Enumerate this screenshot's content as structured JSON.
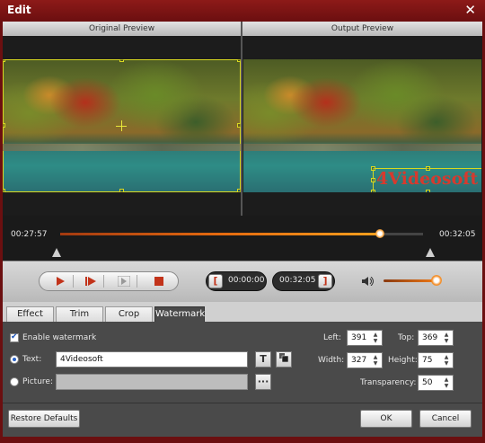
{
  "window": {
    "title": "Edit",
    "close_glyph": "✕"
  },
  "preview": {
    "original_label": "Original Preview",
    "output_label": "Output Preview",
    "watermark_overlay_text": "4Videosoft"
  },
  "timeline": {
    "start_time": "00:27:57",
    "end_time": "00:32:05",
    "progress": 0.88
  },
  "controls": {
    "play_icon": "play-icon",
    "next_frame_icon": "next-frame-icon",
    "frame_step_icon": "frame-step-icon",
    "stop_icon": "stop-icon",
    "clip_start_bracket": "[",
    "clip_start_time": "00:00:00",
    "clip_end_time": "00:32:05",
    "clip_end_bracket": "]",
    "volume_icon": "volume-icon",
    "volume_level": 0.85
  },
  "tabs": [
    {
      "label": "Effect",
      "active": false
    },
    {
      "label": "Trim",
      "active": false
    },
    {
      "label": "Crop",
      "active": false
    },
    {
      "label": "Watermark",
      "active": true
    }
  ],
  "watermark": {
    "enable_label": "Enable watermark",
    "enable_checked": true,
    "text_label": "Text:",
    "text_value": "4Videosoft",
    "text_selected": true,
    "picture_label": "Picture:",
    "picture_value": "",
    "font_button": "T",
    "browse_button": "···",
    "left_label": "Left:",
    "left_value": "391",
    "top_label": "Top:",
    "top_value": "369",
    "width_label": "Width:",
    "width_value": "327",
    "height_label": "Height:",
    "height_value": "75",
    "transparency_label": "Transparency:",
    "transparency_value": "50"
  },
  "footer": {
    "restore_label": "Restore Defaults",
    "ok_label": "OK",
    "cancel_label": "Cancel"
  },
  "colors": {
    "frame": "#6b0f10",
    "accent_orange": "#f07a16",
    "watermark_red": "#d63a2e",
    "selection_yellow": "#d8d820"
  }
}
